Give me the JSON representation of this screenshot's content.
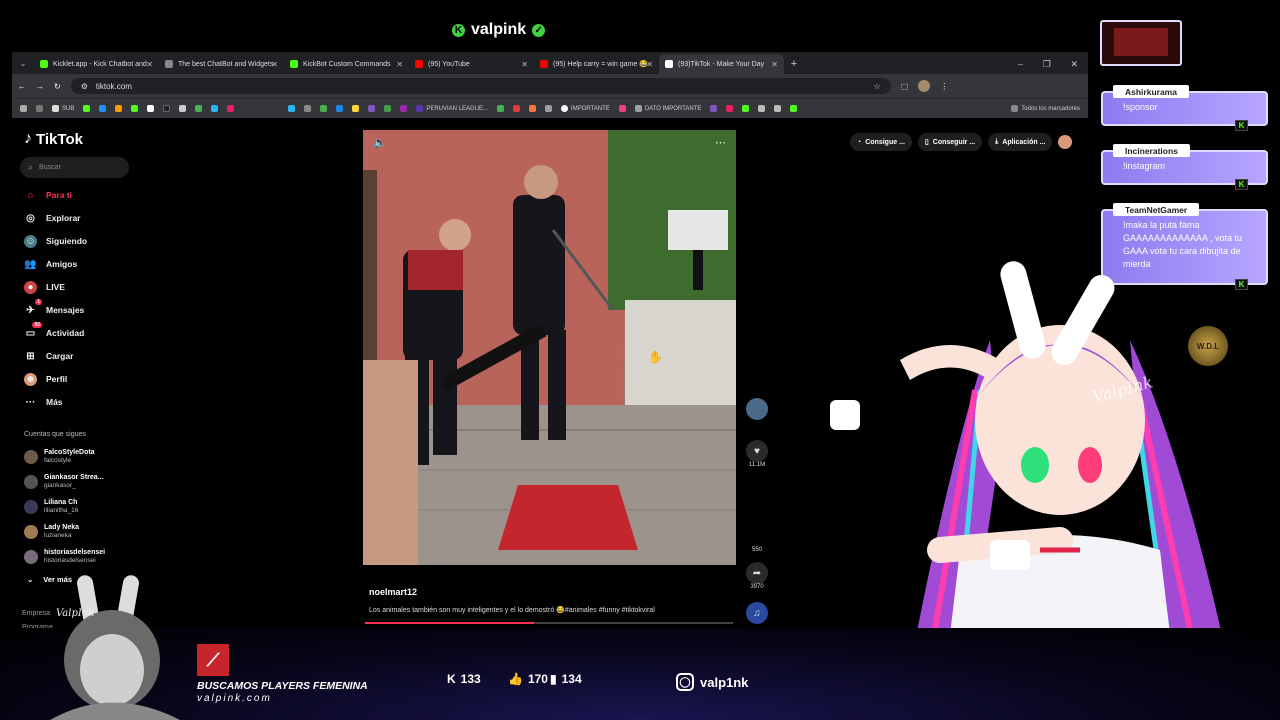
{
  "stream": {
    "title": "valpink"
  },
  "browser": {
    "tabs": [
      {
        "label": "Kicklet.app - Kick Chatbot and",
        "color": "#53fc18"
      },
      {
        "label": "The best ChatBot and Widgets",
        "color": "#888"
      },
      {
        "label": "KickBot Custom Commands",
        "color": "#53fc18"
      },
      {
        "label": "(95) YouTube",
        "color": "#ff0000"
      },
      {
        "label": "(95) Help carry = win game 😂",
        "color": "#ff0000"
      },
      {
        "label": "(93)TikTok - Make Your Day",
        "color": "#fff"
      }
    ],
    "url": "tiktok.com",
    "bookmarks_sub": "SUB",
    "bookmarks_peru": "PERUVIAN LEAGUE...",
    "bookmarks_importante": "IMPORTANTE",
    "bookmarks_dato": "DATO IMPORTANTE",
    "bookmarks_all": "Todos los marcadores"
  },
  "tiktok": {
    "logo": "TikTok",
    "search_placeholder": "Buscar",
    "nav": [
      {
        "label": "Para ti",
        "icon": "home-icon"
      },
      {
        "label": "Explorar",
        "icon": "compass-icon"
      },
      {
        "label": "Siguiendo",
        "icon": "following-icon"
      },
      {
        "label": "Amigos",
        "icon": "friends-icon"
      },
      {
        "label": "LIVE",
        "icon": "live-icon"
      },
      {
        "label": "Mensajes",
        "icon": "messages-icon"
      },
      {
        "label": "Actividad",
        "icon": "activity-icon"
      },
      {
        "label": "Cargar",
        "icon": "upload-icon"
      },
      {
        "label": "Perfil",
        "icon": "profile-icon"
      },
      {
        "label": "Más",
        "icon": "more-icon"
      }
    ],
    "messages_badge": "1",
    "activity_badge": "92",
    "following_title": "Cuentas que sigues",
    "following": [
      {
        "name": "FalcoStyleDota",
        "handle": "falcostyle"
      },
      {
        "name": "Giankasor Strea...",
        "handle": "giankasor_"
      },
      {
        "name": "Liliana Ch",
        "handle": "lilianitha_16"
      },
      {
        "name": "Lady Neka",
        "handle": "luzianeka"
      },
      {
        "name": "historiasdelsensei",
        "handle": "historiasdelsensei"
      }
    ],
    "see_more": "Ver más",
    "footer_1": "Empresa",
    "footer_2": "Programa",
    "top_actions": [
      "Consigue ...",
      "Conseguir ...",
      "Aplicación ..."
    ],
    "video": {
      "author": "noelmart12",
      "caption": "Los animales también son muy inteligentes y el lo demostró 😂#animales #funny #tiktokviral",
      "likes": "11.1M",
      "shares_count": "550",
      "saves": "3970",
      "progress": 0.46
    }
  },
  "chat": [
    {
      "user": "Ashirkurama",
      "message": "!sponsor"
    },
    {
      "user": "Incinerations",
      "message": "!instagram"
    },
    {
      "user": "TeamNetGamer",
      "message": "!maka la puta fama GAAAAAAAAAAAAA , vota tu GAAA vota tu cara dibujita de mierda"
    }
  ],
  "overlay": {
    "promo_title": "BUSCAMOS PLAYERS FEMENINA",
    "promo_site": "valpink.com",
    "kick_followers": "133",
    "likes": "170",
    "views": "134",
    "instagram": "valp1nk",
    "avatar_sign": "ValpInk"
  }
}
